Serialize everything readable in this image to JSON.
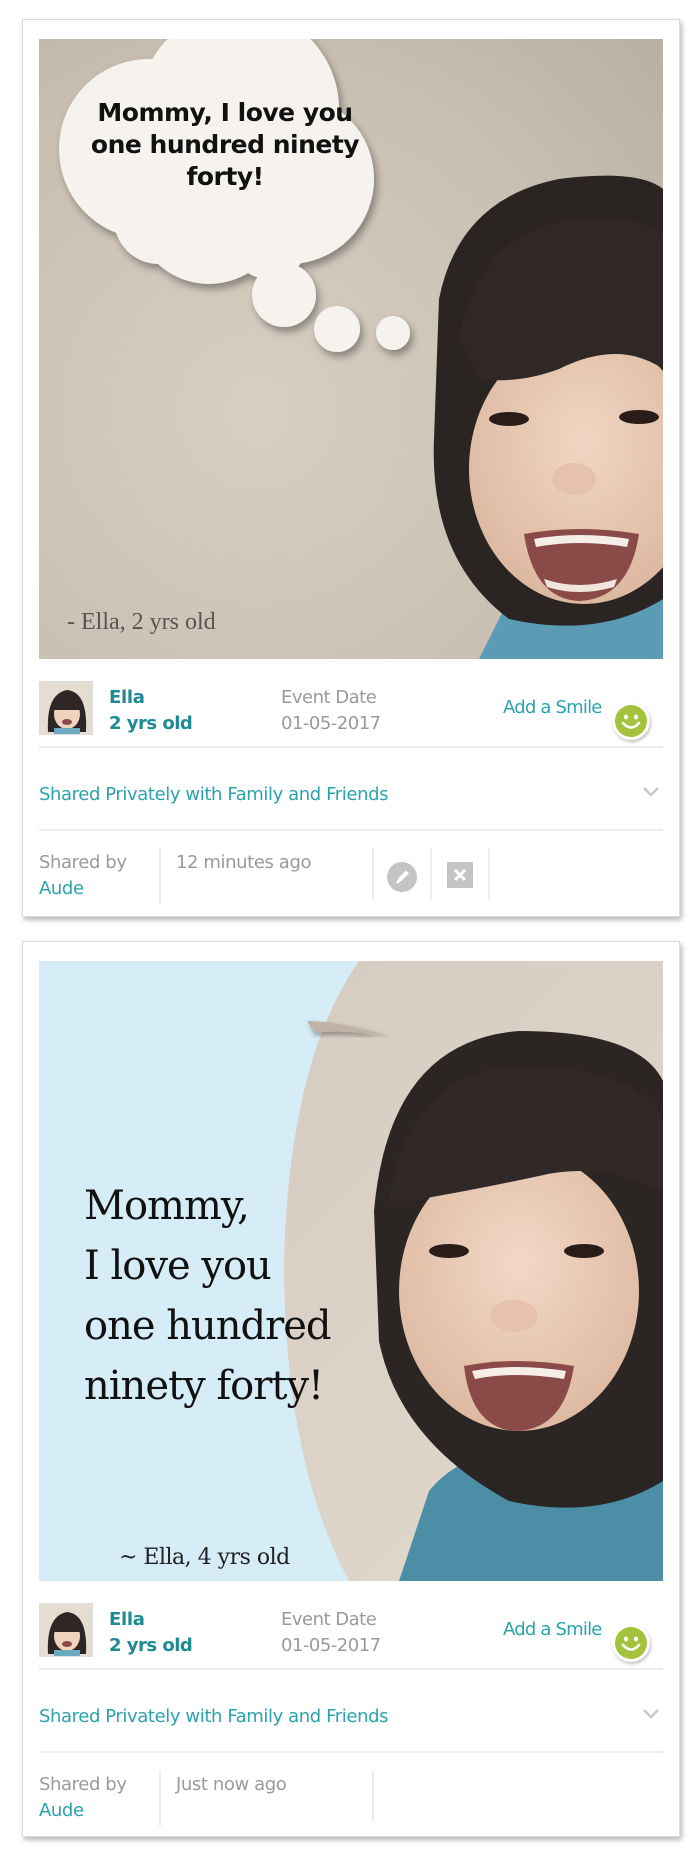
{
  "posts": [
    {
      "image": {
        "style": "thought-bubble",
        "caption_lines": [
          "Mommy, I love you",
          "one hundred ninety",
          "forty!"
        ],
        "attribution": "- Ella, 2 yrs old"
      },
      "child": {
        "name": "Ella",
        "age": "2 yrs old"
      },
      "event": {
        "label": "Event Date",
        "date": "01-05-2017"
      },
      "add_smile_label": "Add a Smile",
      "privacy_label": "Shared Privately with Family and Friends",
      "shared_by_label": "Shared by",
      "shared_by_name": "Aude",
      "time_ago": "12 minutes ago",
      "actions": [
        {
          "name": "edit",
          "icon": "pencil-icon"
        },
        {
          "name": "delete",
          "icon": "close-icon"
        }
      ]
    },
    {
      "image": {
        "style": "blue-panel",
        "caption_lines": [
          "Mommy,",
          "I love you",
          "one hundred",
          "ninety forty!"
        ],
        "attribution": "~ Ella, 4 yrs old"
      },
      "child": {
        "name": "Ella",
        "age": "2 yrs old"
      },
      "event": {
        "label": "Event Date",
        "date": "01-05-2017"
      },
      "add_smile_label": "Add a Smile",
      "privacy_label": "Shared Privately with Family and Friends",
      "shared_by_label": "Shared by",
      "shared_by_name": "Aude",
      "time_ago": "Just now ago",
      "actions": []
    }
  ],
  "colors": {
    "accent_teal": "#2aa3ad",
    "name_teal": "#1d8a94",
    "smile_green": "#a5c23c",
    "muted_gray": "#9a9a9a",
    "panel_blue": "#d6edf8"
  }
}
